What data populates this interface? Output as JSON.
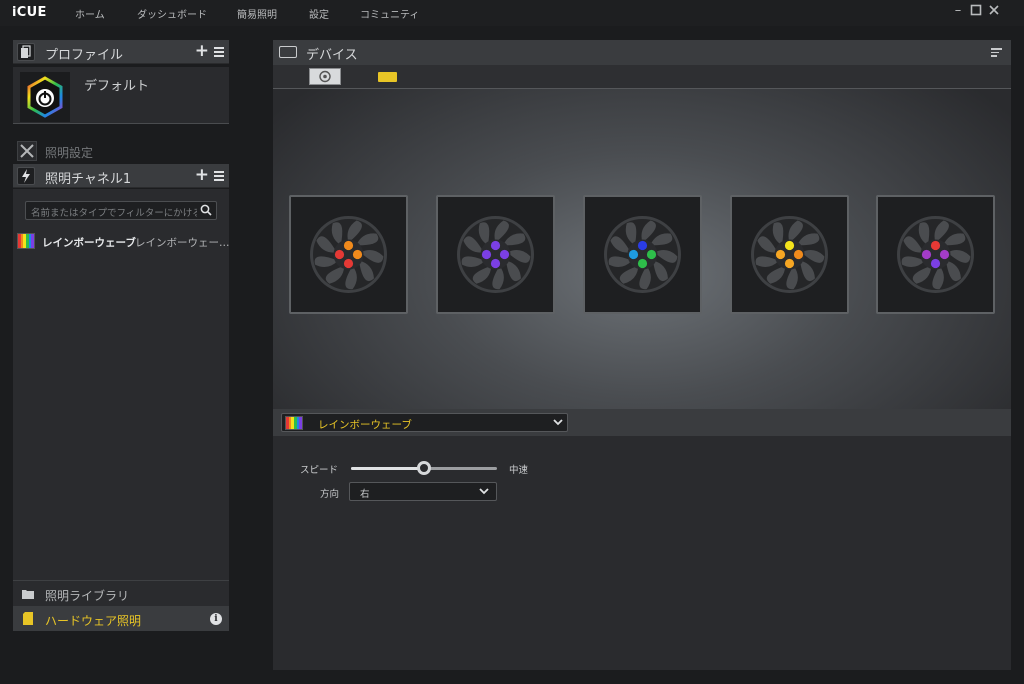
{
  "app": {
    "brand": "iCUE",
    "nav": [
      "ホーム",
      "ダッシュボード",
      "簡易照明",
      "設定",
      "コミュニティ"
    ]
  },
  "profile_panel": {
    "title": "プロファイル",
    "add_icon": "plus-icon",
    "menu_icon": "menu-icon",
    "profile_name": "デフォルト"
  },
  "lighting_settings": {
    "label": "照明設定"
  },
  "lighting_channel": {
    "title": "照明チャネル1",
    "filter_placeholder": "名前またはタイプでフィルターにかける",
    "effects": [
      {
        "name": "レインボーウェーブ",
        "type": "レインボーウェー…"
      }
    ]
  },
  "library": {
    "label": "照明ライブラリ"
  },
  "hardware": {
    "label": "ハードウェア照明",
    "info_glyph": "i"
  },
  "devices": {
    "title": "デバイス"
  },
  "fans": [
    {
      "leds": [
        "#f08a1c",
        "#e53935",
        "#f08a1c",
        "#e53935"
      ]
    },
    {
      "leds": [
        "#7b3fe4",
        "#7b3fe4",
        "#7b3fe4",
        "#7b3fe4"
      ]
    },
    {
      "leds": [
        "#2a3ce6",
        "#1e9be0",
        "#2ebd4a",
        "#2ebd4a"
      ]
    },
    {
      "leds": [
        "#f3e21c",
        "#f6a623",
        "#f08a1c",
        "#f6a623"
      ]
    },
    {
      "leds": [
        "#e53935",
        "#a43cc8",
        "#a43cc8",
        "#7b3fe4"
      ]
    }
  ],
  "effect_selector": {
    "value": "レインボーウェーブ"
  },
  "settings": {
    "speed_label": "スピード",
    "speed_value": "中速",
    "speed_fraction": 0.5,
    "direction_label": "方向",
    "direction_value": "右"
  },
  "colors": {
    "accent_yellow": "#e8c526",
    "panel": "#2a2b2e",
    "header": "#3a3c3f"
  },
  "rainbow": [
    "#e53935",
    "#f08a1c",
    "#f3e21c",
    "#2ebd4a",
    "#1e88e5",
    "#7b3fe4"
  ]
}
